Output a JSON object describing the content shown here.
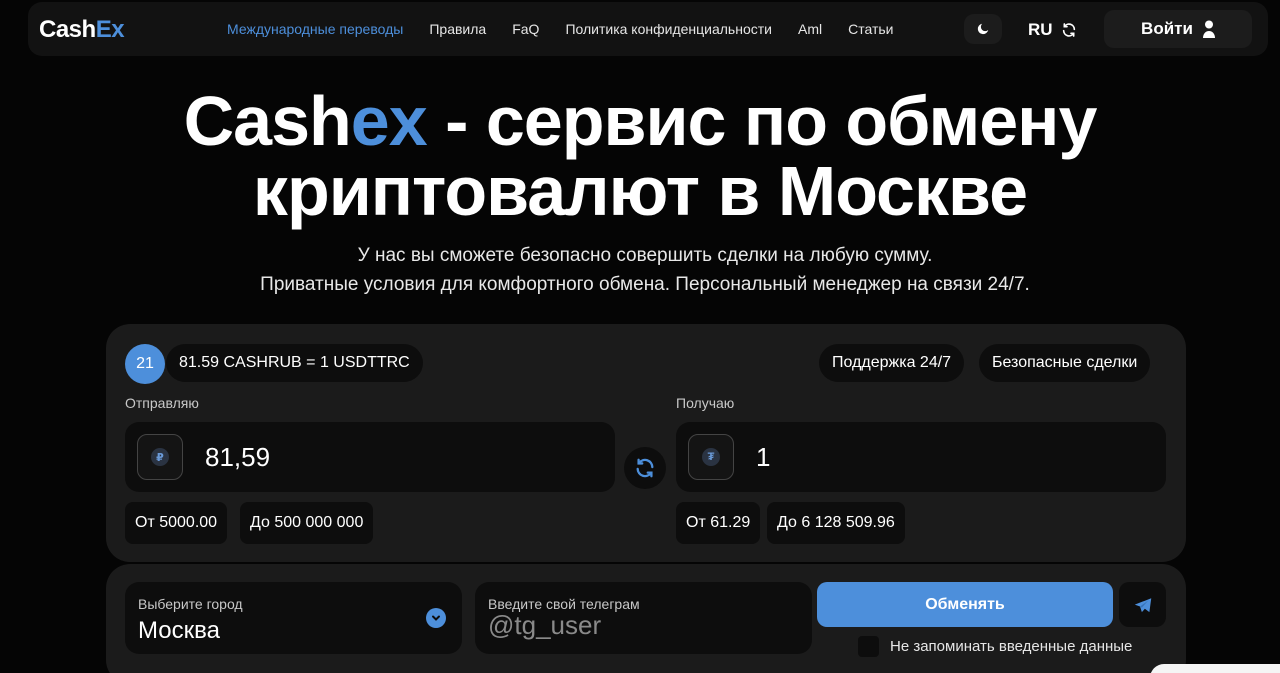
{
  "nav": {
    "logo_main": "Cash",
    "logo_accent": "Ex",
    "items": [
      {
        "label": "Международные переводы"
      },
      {
        "label": "Правила"
      },
      {
        "label": "FaQ"
      },
      {
        "label": "Политика конфиденциальности"
      },
      {
        "label": "Aml"
      },
      {
        "label": "Статьи"
      }
    ],
    "theme_icon": "moon-icon",
    "lang": "RU",
    "login_label": "Войти",
    "active_color": "#4d8fdb"
  },
  "hero": {
    "title_part1": "Cash",
    "title_accent": "ex",
    "title_part2": " - сервис по обмену",
    "title_line2": "криптовалют в Москве",
    "subtitle_line1": "У нас вы сможете безопасно совершить сделки на любую сумму.",
    "subtitle_line2": "Приватные условия для комфортного обмена. Персональный менеджер на связи 24/7."
  },
  "exchange": {
    "timer": "21",
    "rate": "81.59 CASHRUB = 1 USDTTRC",
    "tags": [
      "Поддержка 24/7",
      "Безопасные сделки"
    ],
    "send": {
      "label": "Отправляю",
      "currency_icon": "ruble-icon",
      "amount": "81,59",
      "min": "От 5000.00",
      "max": "До 500 000 000"
    },
    "receive": {
      "label": "Получаю",
      "currency_icon": "tether-icon",
      "amount": "1",
      "min": "От 61.29",
      "max": "До 6 128 509.96"
    }
  },
  "form": {
    "city_label": "Выберите город",
    "city_value": "Москва",
    "telegram_label": "Введите свой телеграм",
    "telegram_placeholder": "@tg_user",
    "submit_label": "Обменять",
    "remember_label": "Не запоминать введенные данные",
    "accent_color": "#4d8fdb"
  }
}
